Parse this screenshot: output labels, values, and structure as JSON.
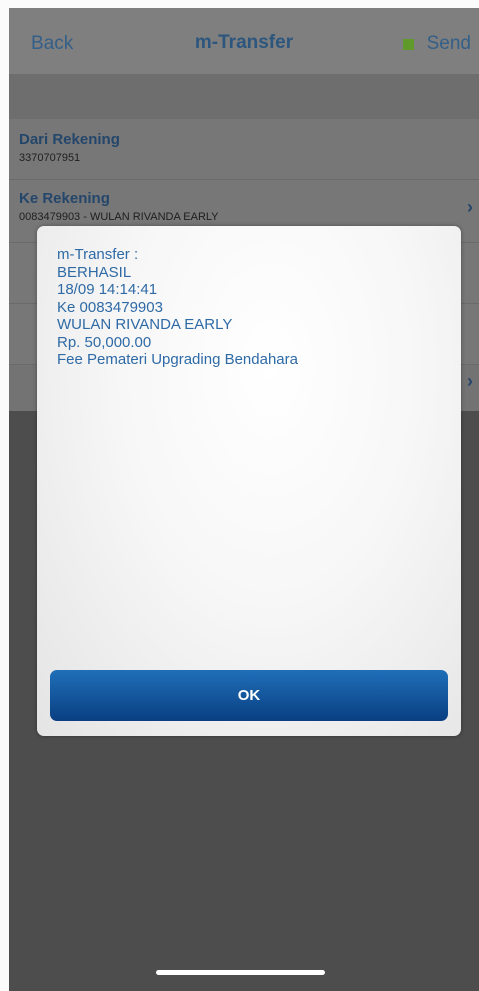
{
  "navbar": {
    "back_label": "Back",
    "title": "m-Transfer",
    "send_label": "Send",
    "send_icon": "square-icon",
    "send_icon_color": "#5f9a2a"
  },
  "form": {
    "from": {
      "label": "Dari Rekening",
      "value": "3370707951"
    },
    "to": {
      "label": "Ke Rekening",
      "value": "0083479903 - WULAN RIVANDA EARLY"
    }
  },
  "dialog": {
    "lines": [
      "m-Transfer :",
      "BERHASIL",
      "18/09 14:14:41",
      "Ke 0083479903",
      "WULAN RIVANDA EARLY",
      "Rp. 50,000.00",
      "Fee Pemateri Upgrading Bendahara"
    ],
    "ok_label": "OK",
    "text_color": "#2e6aa6",
    "button_color": "#0f58a0"
  }
}
